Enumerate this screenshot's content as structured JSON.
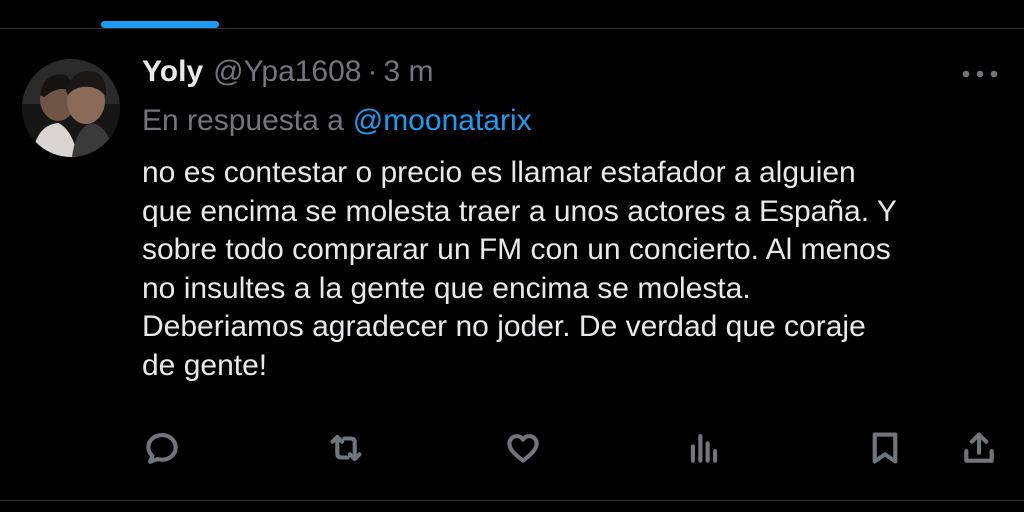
{
  "tweet": {
    "display_name": "Yoly",
    "handle": "@Ypa1608",
    "separator": "·",
    "time": "3 m",
    "reply_prefix": "En respuesta a",
    "reply_to": "@moonatarix",
    "text": "no es contestar o precio es llamar estafador a alguien\nque encima se molesta traer a unos actores a España. Y\nsobre todo comprarar un FM con un concierto. Al menos\nno insultes a la gente que encima se molesta.\nDeberiamos agradecer no joder. De verdad que coraje\nde gente!"
  },
  "actions": [
    {
      "name": "reply",
      "icon": "comment-icon"
    },
    {
      "name": "retweet",
      "icon": "retweet-icon"
    },
    {
      "name": "like",
      "icon": "heart-icon"
    },
    {
      "name": "views",
      "icon": "bar-chart-icon"
    },
    {
      "name": "bookmark",
      "icon": "bookmark-icon"
    },
    {
      "name": "share",
      "icon": "share-icon"
    }
  ],
  "colors": {
    "background": "#000000",
    "text_primary": "#e7e9ea",
    "text_secondary": "#71767b",
    "accent": "#1d9bf0",
    "divider": "#2f3336"
  }
}
